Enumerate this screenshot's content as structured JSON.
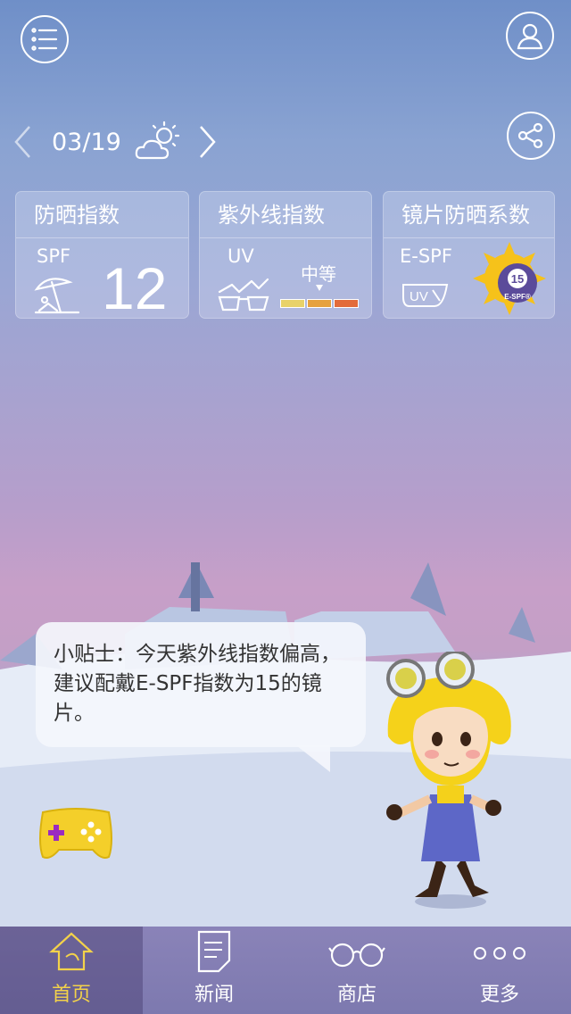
{
  "header": {
    "menu_icon": "menu-list-icon",
    "profile_icon": "user-icon",
    "share_icon": "share-icon"
  },
  "date_bar": {
    "date": "03/19",
    "weather_icon": "partly-cloudy-sun-icon"
  },
  "cards": {
    "sunscreen": {
      "title": "防晒指数",
      "label": "SPF",
      "value": "12",
      "icon": "beach-umbrella-icon"
    },
    "uv": {
      "title": "紫外线指数",
      "label": "UV",
      "level": "中等",
      "icon": "uv-glasses-icon",
      "scale_colors": [
        "#e8d26a",
        "#e6a13e",
        "#e36b3a"
      ]
    },
    "lens": {
      "title": "镜片防晒系数",
      "label": "E-SPF",
      "badge_value": "15",
      "badge_text": "E-SPF®",
      "icon": "uv-lens-icon"
    }
  },
  "tip": {
    "text": "小贴士：今天紫外线指数偏高，建议配戴E-SPF指数为15的镜片。"
  },
  "game_icon": "gamepad-icon",
  "tabs": [
    {
      "label": "首页",
      "icon": "home-icon",
      "active": true
    },
    {
      "label": "新闻",
      "icon": "news-icon",
      "active": false
    },
    {
      "label": "商店",
      "icon": "glasses-icon",
      "active": false
    },
    {
      "label": "更多",
      "icon": "more-dots-icon",
      "active": false
    }
  ]
}
